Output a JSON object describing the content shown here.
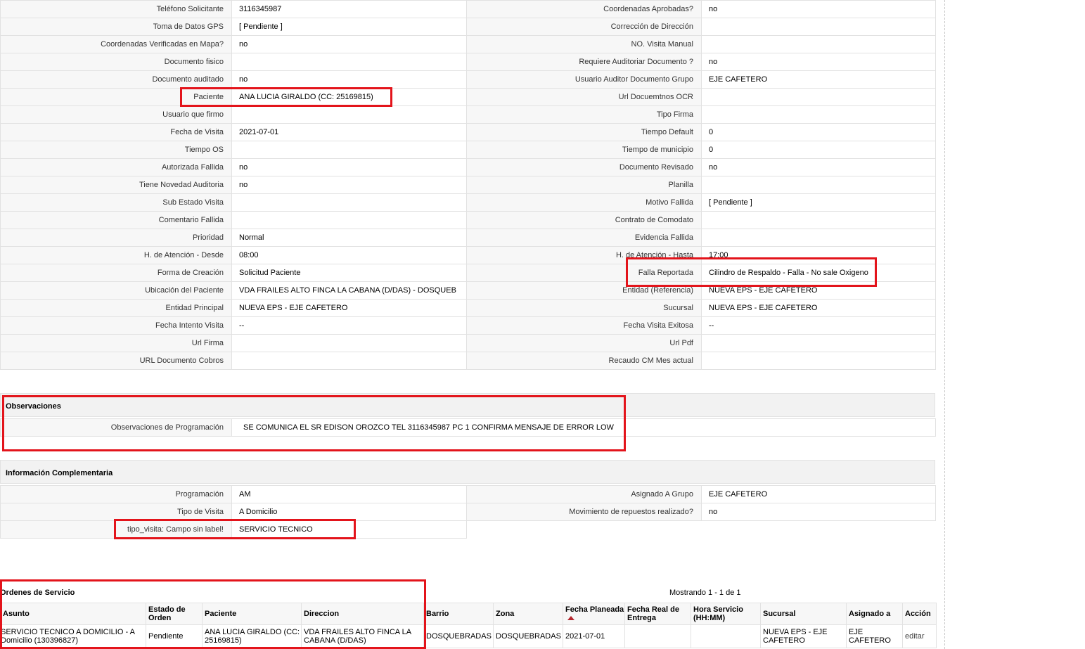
{
  "details": [
    {
      "l1": "Teléfono Solicitante",
      "v1": "3116345987",
      "l2": "Coordenadas Aprobadas?",
      "v2": "no"
    },
    {
      "l1": "Toma de Datos GPS",
      "v1": "[ Pendiente ]",
      "l2": "Corrección de Dirección",
      "v2": ""
    },
    {
      "l1": "Coordenadas Verificadas en Mapa?",
      "v1": "no",
      "l2": "NO. Visita Manual",
      "v2": ""
    },
    {
      "l1": "Documento fisico",
      "v1": "",
      "l2": "Requiere Auditoriar Documento ?",
      "v2": "no"
    },
    {
      "l1": "Documento auditado",
      "v1": "no",
      "l2": "Usuario Auditor Documento Grupo",
      "v2": "EJE CAFETERO"
    },
    {
      "l1": "Paciente",
      "v1": "ANA LUCIA GIRALDO (CC: 25169815)",
      "l2": "Url Docuemtnos OCR",
      "v2": ""
    },
    {
      "l1": "Usuario que firmo",
      "v1": "",
      "l2": "Tipo Firma",
      "v2": ""
    },
    {
      "l1": "Fecha de Visita",
      "v1": "2021-07-01",
      "l2": "Tiempo Default",
      "v2": "0"
    },
    {
      "l1": "Tiempo OS",
      "v1": "",
      "l2": "Tiempo de municipio",
      "v2": "0"
    },
    {
      "l1": "Autorizada Fallida",
      "v1": "no",
      "l2": "Documento Revisado",
      "v2": "no"
    },
    {
      "l1": "Tiene Novedad Auditoria",
      "v1": "no",
      "l2": "Planilla",
      "v2": ""
    },
    {
      "l1": "Sub Estado Visita",
      "v1": "",
      "l2": "Motivo Fallida",
      "v2": "[ Pendiente ]"
    },
    {
      "l1": "Comentario Fallida",
      "v1": "",
      "l2": "Contrato de Comodato",
      "v2": ""
    },
    {
      "l1": "Prioridad",
      "v1": "Normal",
      "l2": "Evidencia Fallida",
      "v2": ""
    },
    {
      "l1": "H. de Atención - Desde",
      "v1": "08:00",
      "l2": "H. de Atención - Hasta",
      "v2": "17:00"
    },
    {
      "l1": "Forma de Creación",
      "v1": "Solicitud Paciente",
      "l2": "Falla Reportada",
      "v2": "Cilindro de Respaldo - Falla - No sale Oxigeno"
    },
    {
      "l1": "Ubicación del Paciente",
      "v1": "VDA FRAILES ALTO FINCA LA CABANA (D/DAS) - DOSQUEB",
      "l2": "Entidad (Referencia)",
      "v2": "NUEVA EPS - EJE CAFETERO"
    },
    {
      "l1": "Entidad Principal",
      "v1": "NUEVA EPS - EJE CAFETERO",
      "l2": "Sucursal",
      "v2": "NUEVA EPS - EJE CAFETERO"
    },
    {
      "l1": "Fecha Intento Visita",
      "v1": "--",
      "l2": "Fecha Visita Exitosa",
      "v2": "--"
    },
    {
      "l1": "Url Firma",
      "v1": "",
      "l2": "Url Pdf",
      "v2": ""
    },
    {
      "l1": "URL Documento Cobros",
      "v1": "",
      "l2": "Recaudo CM Mes actual",
      "v2": ""
    }
  ],
  "observaciones": {
    "title": "Observaciones",
    "label": "Observaciones de Programación",
    "value": "SE COMUNICA EL SR EDISON OROZCO TEL 3116345987 PC 1 CONFIRMA MENSAJE DE ERROR LOW"
  },
  "complementaria": {
    "title": "Información Complementaria",
    "rows": [
      {
        "l1": "Programación",
        "v1": "AM",
        "l2": "Asignado A Grupo",
        "v2": "EJE CAFETERO"
      },
      {
        "l1": "Tipo de Visita",
        "v1": "A Domicilio",
        "l2": "Movimiento de repuestos realizado?",
        "v2": "no"
      }
    ],
    "extra_label": "tipo_visita: Campo sin label!",
    "extra_value": "SERVICIO TECNICO"
  },
  "ordenes": {
    "title": "Ordenes de Servicio",
    "showing": "Mostrando 1 - 1 de 1",
    "columns": [
      "Asunto",
      "Estado de Orden",
      "Paciente",
      "Direccion",
      "Barrio",
      "Zona",
      "Fecha Planeada",
      "Fecha Real de Entrega",
      "Hora Servicio (HH:MM)",
      "Sucursal",
      "Asignado a",
      "Acción"
    ],
    "rows": [
      [
        "SERVICIO TECNICO A DOMICILIO - A Domicilio (130396827)",
        "Pendiente",
        "ANA LUCIA GIRALDO (CC: 25169815)",
        "VDA FRAILES ALTO FINCA LA CABANA (D/DAS)",
        "DOSQUEBRADAS",
        "DOSQUEBRADAS",
        "2021-07-01",
        "",
        "",
        "NUEVA EPS - EJE CAFETERO",
        "EJE CAFETERO",
        "editar"
      ]
    ]
  },
  "colors": {
    "highlight": "#e3141b",
    "label_bg": "#f7f7f7",
    "border": "#e2e2e2"
  }
}
